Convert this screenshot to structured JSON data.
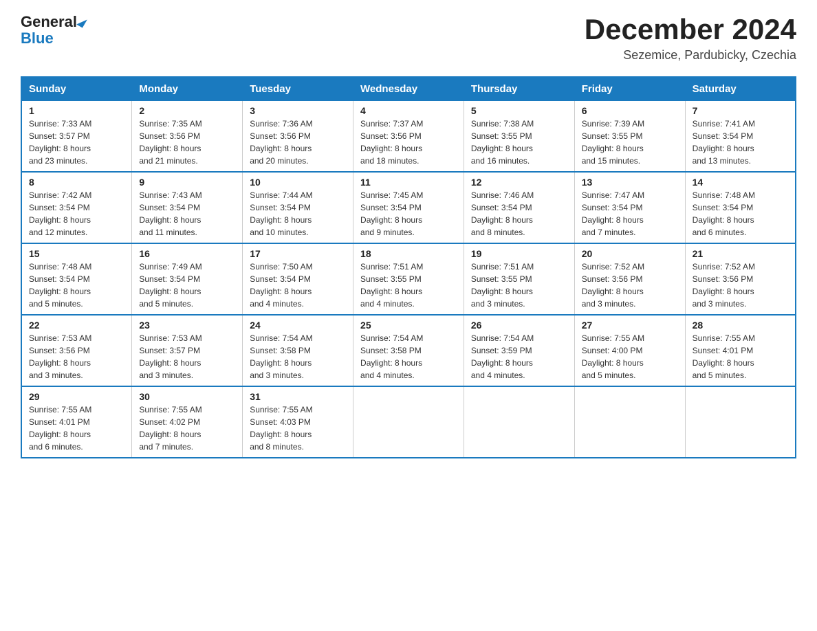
{
  "logo": {
    "general": "General",
    "blue": "Blue"
  },
  "title": "December 2024",
  "location": "Sezemice, Pardubicky, Czechia",
  "days_of_week": [
    "Sunday",
    "Monday",
    "Tuesday",
    "Wednesday",
    "Thursday",
    "Friday",
    "Saturday"
  ],
  "weeks": [
    [
      {
        "day": "1",
        "sunrise": "7:33 AM",
        "sunset": "3:57 PM",
        "daylight": "8 hours and 23 minutes."
      },
      {
        "day": "2",
        "sunrise": "7:35 AM",
        "sunset": "3:56 PM",
        "daylight": "8 hours and 21 minutes."
      },
      {
        "day": "3",
        "sunrise": "7:36 AM",
        "sunset": "3:56 PM",
        "daylight": "8 hours and 20 minutes."
      },
      {
        "day": "4",
        "sunrise": "7:37 AM",
        "sunset": "3:56 PM",
        "daylight": "8 hours and 18 minutes."
      },
      {
        "day": "5",
        "sunrise": "7:38 AM",
        "sunset": "3:55 PM",
        "daylight": "8 hours and 16 minutes."
      },
      {
        "day": "6",
        "sunrise": "7:39 AM",
        "sunset": "3:55 PM",
        "daylight": "8 hours and 15 minutes."
      },
      {
        "day": "7",
        "sunrise": "7:41 AM",
        "sunset": "3:54 PM",
        "daylight": "8 hours and 13 minutes."
      }
    ],
    [
      {
        "day": "8",
        "sunrise": "7:42 AM",
        "sunset": "3:54 PM",
        "daylight": "8 hours and 12 minutes."
      },
      {
        "day": "9",
        "sunrise": "7:43 AM",
        "sunset": "3:54 PM",
        "daylight": "8 hours and 11 minutes."
      },
      {
        "day": "10",
        "sunrise": "7:44 AM",
        "sunset": "3:54 PM",
        "daylight": "8 hours and 10 minutes."
      },
      {
        "day": "11",
        "sunrise": "7:45 AM",
        "sunset": "3:54 PM",
        "daylight": "8 hours and 9 minutes."
      },
      {
        "day": "12",
        "sunrise": "7:46 AM",
        "sunset": "3:54 PM",
        "daylight": "8 hours and 8 minutes."
      },
      {
        "day": "13",
        "sunrise": "7:47 AM",
        "sunset": "3:54 PM",
        "daylight": "8 hours and 7 minutes."
      },
      {
        "day": "14",
        "sunrise": "7:48 AM",
        "sunset": "3:54 PM",
        "daylight": "8 hours and 6 minutes."
      }
    ],
    [
      {
        "day": "15",
        "sunrise": "7:48 AM",
        "sunset": "3:54 PM",
        "daylight": "8 hours and 5 minutes."
      },
      {
        "day": "16",
        "sunrise": "7:49 AM",
        "sunset": "3:54 PM",
        "daylight": "8 hours and 5 minutes."
      },
      {
        "day": "17",
        "sunrise": "7:50 AM",
        "sunset": "3:54 PM",
        "daylight": "8 hours and 4 minutes."
      },
      {
        "day": "18",
        "sunrise": "7:51 AM",
        "sunset": "3:55 PM",
        "daylight": "8 hours and 4 minutes."
      },
      {
        "day": "19",
        "sunrise": "7:51 AM",
        "sunset": "3:55 PM",
        "daylight": "8 hours and 3 minutes."
      },
      {
        "day": "20",
        "sunrise": "7:52 AM",
        "sunset": "3:56 PM",
        "daylight": "8 hours and 3 minutes."
      },
      {
        "day": "21",
        "sunrise": "7:52 AM",
        "sunset": "3:56 PM",
        "daylight": "8 hours and 3 minutes."
      }
    ],
    [
      {
        "day": "22",
        "sunrise": "7:53 AM",
        "sunset": "3:56 PM",
        "daylight": "8 hours and 3 minutes."
      },
      {
        "day": "23",
        "sunrise": "7:53 AM",
        "sunset": "3:57 PM",
        "daylight": "8 hours and 3 minutes."
      },
      {
        "day": "24",
        "sunrise": "7:54 AM",
        "sunset": "3:58 PM",
        "daylight": "8 hours and 3 minutes."
      },
      {
        "day": "25",
        "sunrise": "7:54 AM",
        "sunset": "3:58 PM",
        "daylight": "8 hours and 4 minutes."
      },
      {
        "day": "26",
        "sunrise": "7:54 AM",
        "sunset": "3:59 PM",
        "daylight": "8 hours and 4 minutes."
      },
      {
        "day": "27",
        "sunrise": "7:55 AM",
        "sunset": "4:00 PM",
        "daylight": "8 hours and 5 minutes."
      },
      {
        "day": "28",
        "sunrise": "7:55 AM",
        "sunset": "4:01 PM",
        "daylight": "8 hours and 5 minutes."
      }
    ],
    [
      {
        "day": "29",
        "sunrise": "7:55 AM",
        "sunset": "4:01 PM",
        "daylight": "8 hours and 6 minutes."
      },
      {
        "day": "30",
        "sunrise": "7:55 AM",
        "sunset": "4:02 PM",
        "daylight": "8 hours and 7 minutes."
      },
      {
        "day": "31",
        "sunrise": "7:55 AM",
        "sunset": "4:03 PM",
        "daylight": "8 hours and 8 minutes."
      },
      null,
      null,
      null,
      null
    ]
  ],
  "labels": {
    "sunrise": "Sunrise:",
    "sunset": "Sunset:",
    "daylight": "Daylight:"
  }
}
